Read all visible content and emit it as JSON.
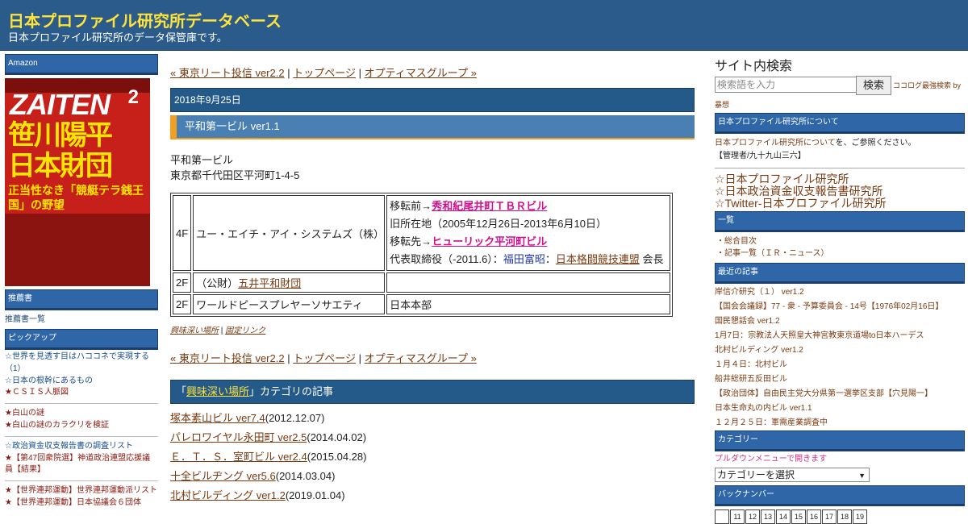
{
  "header": {
    "title": "日本プロファイル研究所データベース",
    "subtitle": "日本プロファイル研究所のデータ保管庫です。"
  },
  "left": {
    "amazon_title": "Amazon",
    "ad": {
      "issue": "2",
      "logo": "ZAITEN",
      "headline1": "笹川陽平",
      "headline2": "日本財団",
      "headline3": "正当性なき「競艇テラ銭王国」の野望"
    },
    "recommend_title": "推薦書",
    "recommend_link": "推薦書一覧",
    "pickup_title": "ピックアップ",
    "pickup_groups": [
      [
        "☆世界を見透す目はハココネで実現する（1）",
        "☆日本の根幹にあるもの",
        "★ＣＳＩＳ人脈図"
      ],
      [
        "★白山の謎",
        "★白山の謎のカラクリを検証"
      ],
      [
        "☆政治資金収支報告書の調査リスト",
        "★【第47回衆院選】神道政治連盟応援議員【結果】"
      ],
      [
        "★【世界連邦運動】世界連邦運動派リスト",
        "★【世界連邦運動】日本協議会６団体"
      ]
    ]
  },
  "main": {
    "nav": {
      "prev": "« 東京リート投信 ver2.2",
      "top": "トップページ",
      "next": "オプティマスグループ »",
      "sep": " | "
    },
    "date": "2018年9月25日",
    "post_title": "平和第一ビル ver1.1",
    "address_lines": [
      "平和第一ビル",
      "東京都千代田区平河町1-4-5"
    ],
    "rows": [
      {
        "floor": "4F",
        "tenant": "ユー・エイチ・アイ・システムズ（株）",
        "note": {
          "before_label": "移転前→",
          "before_link": "秀和紀尾井町ＴＢＲビル",
          "prev_address": "旧所在地（2005年12月26日-2013年6月10日）",
          "after_label": "移転先→",
          "after_link": "ヒューリック平河町ビル",
          "rep_prefix": "代表取締役（-2011.6）：",
          "rep_name": "福田富昭",
          "rep_sep": "：",
          "rep_org": "日本格闘競技連盟",
          "rep_role": " 会長"
        }
      },
      {
        "floor": "2F",
        "tenant_prefix": "（公財）",
        "tenant_link": "五井平和財団",
        "note": ""
      },
      {
        "floor": "2F",
        "tenant": "ワールドピースプレヤーソサエティ",
        "note": "日本本部"
      }
    ],
    "tags": {
      "tag": "興味深い場所",
      "sep": " | ",
      "permalink": "固定リンク"
    },
    "category_bar": {
      "prefix": "「",
      "name": "興味深い場所",
      "suffix": "」カテゴリの記事"
    },
    "category_articles": [
      {
        "title": "塚本素山ビル ver7.4",
        "date": "(2012.12.07)"
      },
      {
        "title": "パレロワイヤル永田町 ver2.5",
        "date": "(2014.04.02)"
      },
      {
        "title": "Ｅ．Ｔ．Ｓ．室町ビル ver2.4",
        "date": "(2015.04.28)"
      },
      {
        "title": "十全ビルヂング ver5.6",
        "date": "(2014.03.04)"
      },
      {
        "title": "北村ビルディング ver1.2",
        "date": "(2019.01.04)"
      }
    ]
  },
  "right": {
    "search_heading": "サイト内検索",
    "search_placeholder": "検索語を入力",
    "search_button": "検索",
    "search_extra": "ココログ最強検索 by",
    "search_extra2": "暴想",
    "about_title": "日本プロファイル研究所について",
    "about_link": "日本プロファイル研究所について",
    "about_text": "を、ご参照ください。",
    "about_admin": "【管理者/九十九山三六】",
    "star_links": [
      "☆日本プロファイル研究所",
      "☆日本政治資金収支報告書研究所",
      "☆Twitter-日本プロファイル研究所"
    ],
    "list_title": "一覧",
    "list_items": [
      "・総合目次",
      "・記事一覧（ＩＲ・ニュース）"
    ],
    "recent_title": "最近の記事",
    "recent_items": [
      "岸信介研究（１） ver1.2",
      "【国会会議録】77 - 衆 - 予算委員会 - 14号【1976年02月16日】",
      "国民懇話会 ver1.2",
      "1月7日：宗教法人天照皇大神宮教東京道場to日本ハーデス",
      "北村ビルディング ver1.2",
      "１月４日：北村ビル",
      "船井総研五反田ビル",
      "【政治団体】自由民主党大分県第一選挙区支部【穴見陽一】",
      "日本生命丸の内ビル ver1.1",
      "１２月２５日：軍需産業調査中"
    ],
    "category_title": "カテゴリー",
    "category_hint": "プルダウンメニューで開きます",
    "category_select": "カテゴリーを選択",
    "backnumber_title": "バックナンバー",
    "backnumbers": [
      "",
      "11",
      "12",
      "13",
      "14",
      "15",
      "16",
      "17",
      "18",
      "19"
    ]
  }
}
